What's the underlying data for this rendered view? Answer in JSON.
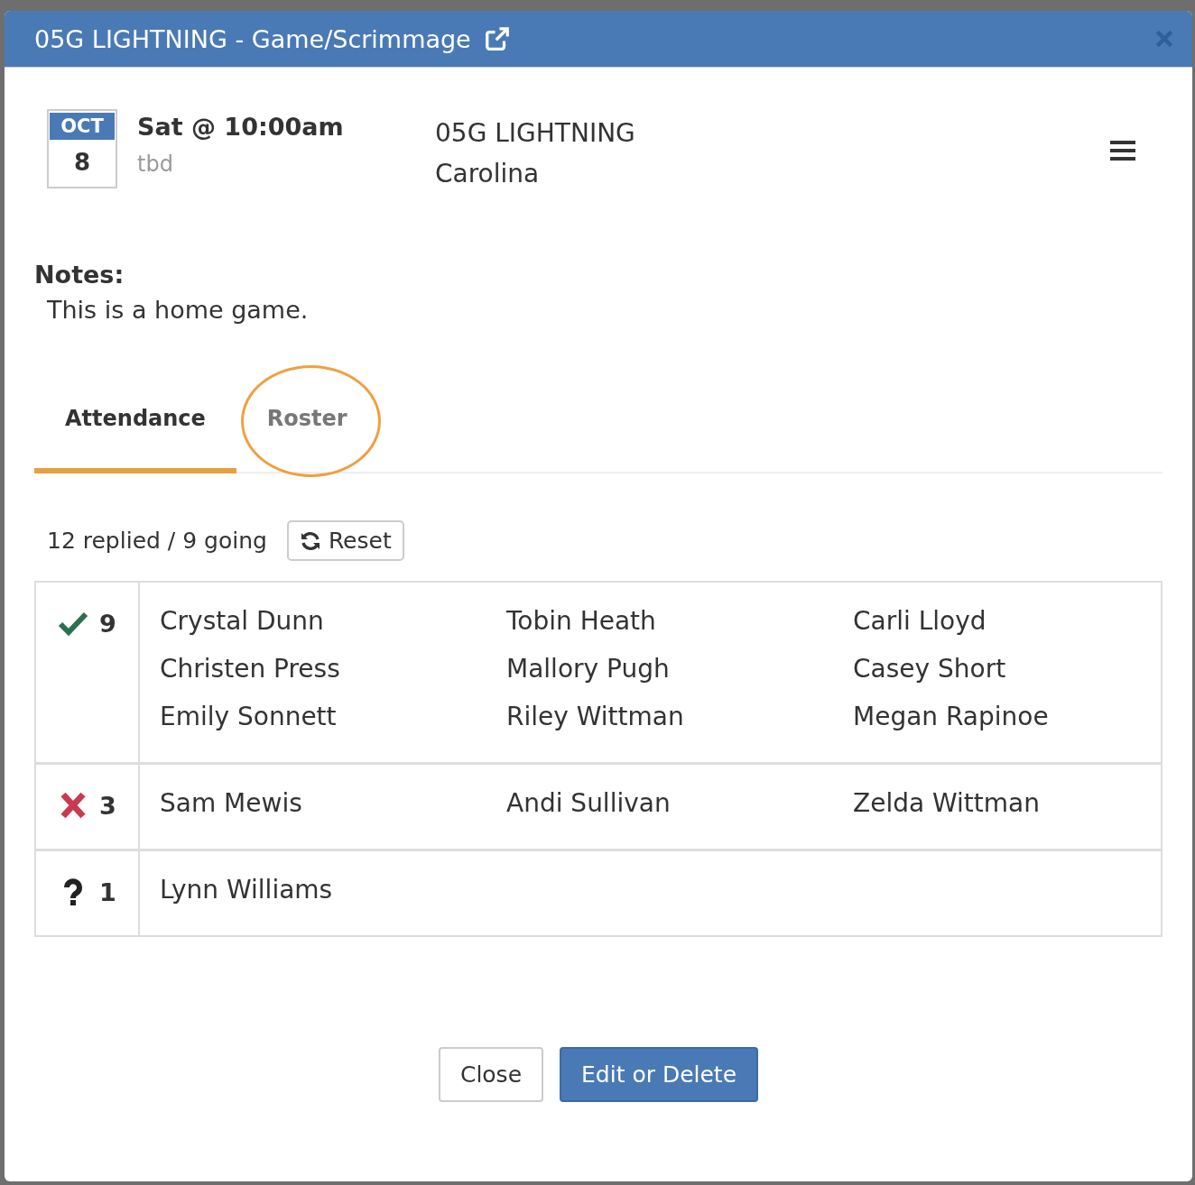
{
  "window": {
    "title": "05G LIGHTNING - Game/Scrimmage"
  },
  "event": {
    "month": "OCT",
    "day": "8",
    "time": "Sat @ 10:00am",
    "location": "tbd",
    "team": "05G LIGHTNING",
    "opponent": "Carolina"
  },
  "notes": {
    "label": "Notes:",
    "text": "This is a home game."
  },
  "tabs": [
    {
      "label": "Attendance",
      "selected": true,
      "circled": false
    },
    {
      "label": "Roster",
      "selected": false,
      "circled": true
    }
  ],
  "summary": {
    "text": "12 replied / 9 going",
    "reset_button": "Reset"
  },
  "attendance": [
    {
      "kind": "yes",
      "count": "9",
      "names": [
        "Crystal Dunn",
        "Tobin Heath",
        "Carli Lloyd",
        "Christen Press",
        "Mallory Pugh",
        "Casey Short",
        "Emily Sonnett",
        "Riley Wittman",
        "Megan Rapinoe"
      ]
    },
    {
      "kind": "no",
      "count": "3",
      "names": [
        "Sam Mewis",
        "Andi Sullivan",
        "Zelda Wittman"
      ]
    },
    {
      "kind": "maybe",
      "count": "1",
      "names": [
        "Lynn Williams"
      ]
    }
  ],
  "buttons": [
    {
      "label": "Close",
      "kind": "default"
    },
    {
      "label": "Edit or Delete",
      "kind": "primary"
    }
  ]
}
